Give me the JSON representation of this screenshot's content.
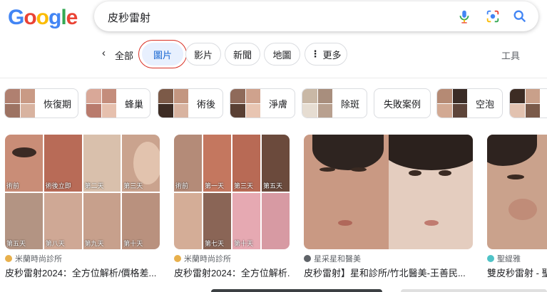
{
  "logo": [
    "G",
    "o",
    "o",
    "g",
    "l",
    "e"
  ],
  "search": {
    "query": "皮秒雷射"
  },
  "nav": {
    "all": "全部",
    "tabs": [
      {
        "label": "圖片",
        "active": true
      },
      {
        "label": "影片",
        "active": false
      },
      {
        "label": "新聞",
        "active": false
      },
      {
        "label": "地圖",
        "active": false
      },
      {
        "label": "更多",
        "active": false
      }
    ],
    "tools": "工具"
  },
  "related": [
    "恢復期",
    "蜂巢",
    "術後",
    "淨膚",
    "除斑",
    "失敗案例",
    "空泡"
  ],
  "results": [
    {
      "tags": [
        "術前",
        "術後立即",
        "第二天",
        "第三天",
        "第五天",
        "第八天",
        "第九天",
        "第十天"
      ],
      "source": "米蘭時尚診所",
      "title": "皮秒雷射2024：全方位解析/價格差..."
    },
    {
      "tags": [
        "術前",
        "第一天",
        "第三天",
        "第五天",
        "第七天",
        "第十天"
      ],
      "source": "米蘭時尚診所",
      "title": "皮秒雷射2024：全方位解析..."
    },
    {
      "source": "星采星和醫美",
      "title": "皮秒雷射】星和診所/竹北醫美-王善民..."
    },
    {
      "source": "聖緹雅",
      "title": "雙皮秒雷射 - 聖"
    }
  ],
  "colors": {
    "accent": "#1967d2",
    "active_bg": "#e8f0fe",
    "ring": "#d93025"
  }
}
